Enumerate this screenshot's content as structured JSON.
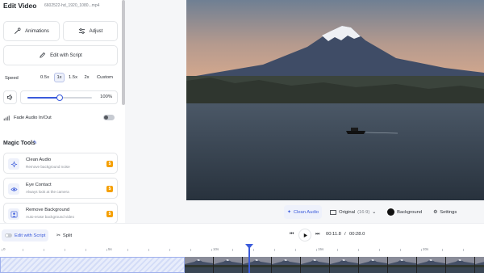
{
  "panel": {
    "title": "Edit Video",
    "filename": "6602522-hd_1920_1080...mp4",
    "animations_label": "Animations",
    "adjust_label": "Adjust",
    "edit_script_label": "Edit with Script",
    "speed": {
      "label": "Speed",
      "options": [
        "0.5x",
        "1x",
        "1.5x",
        "2x",
        "Custom"
      ],
      "selected": "1x"
    },
    "volume": {
      "value_label": "100%",
      "level_fraction": 0.5
    },
    "fade": {
      "label": "Fade Audio In/Out",
      "enabled": false
    }
  },
  "magic_tools": {
    "title": "Magic Tools",
    "items": [
      {
        "name": "Clean Audio",
        "desc": "Remove background noise",
        "icon": "sparkle-icon"
      },
      {
        "name": "Eye Contact",
        "desc": "Always look at the camera",
        "icon": "eye-icon"
      },
      {
        "name": "Remove Background",
        "desc": "Auto-erase background video",
        "icon": "person-icon"
      }
    ]
  },
  "preview_toolbar": {
    "clean_audio": "Clean Audio",
    "aspect": "Original",
    "aspect_ratio": "(16:9)",
    "background": "Background",
    "settings": "Settings"
  },
  "playback": {
    "edit_script": "Edit with Script",
    "split": "Split",
    "current_time": "00:11.8",
    "separator": "/",
    "total_time": "00:28.0"
  },
  "timeline": {
    "labels": [
      "0",
      "5s",
      "10s",
      "15s",
      "20s"
    ]
  },
  "colors": {
    "accent": "#3b5bdb",
    "badge": "#f59f00"
  }
}
